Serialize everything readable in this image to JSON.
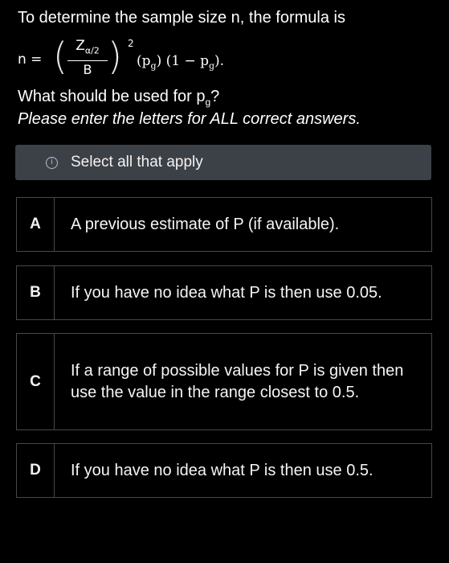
{
  "question": {
    "line1": "To determine the sample size n, the formula is",
    "formula": {
      "lhs": "n =",
      "numerator_main": "Z",
      "numerator_sub": "α/2",
      "denominator": "B",
      "exponent": "2",
      "rest_part1": "(p",
      "rest_sub1": "g",
      "rest_part2": ") (1 − p",
      "rest_sub2": "g",
      "rest_part3": ")."
    },
    "line3_main": "What should be used for p",
    "line3_sub": "g",
    "line3_end": "?",
    "instruction": "Please enter the letters for ALL correct answers."
  },
  "banner": {
    "icon": "info-icon",
    "text": "Select all that apply"
  },
  "options": [
    {
      "letter": "A",
      "text": "A previous estimate of P (if available)."
    },
    {
      "letter": "B",
      "text": "If you have no idea what P is then use 0.05."
    },
    {
      "letter": "C",
      "text": "If a range of possible values for P is given then use the value in the range closest to 0.5."
    },
    {
      "letter": "D",
      "text": "If you have no idea what P is then use 0.5."
    }
  ],
  "colors": {
    "background": "#000000",
    "banner_bg": "#3c4047",
    "border": "#45484d",
    "text": "#ffffff"
  }
}
